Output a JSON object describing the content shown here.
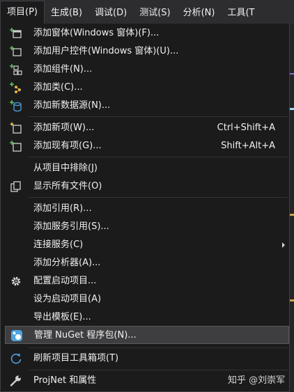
{
  "menubar": {
    "items": [
      {
        "label": "项目(P)"
      },
      {
        "label": "生成(B)"
      },
      {
        "label": "调试(D)"
      },
      {
        "label": "测试(S)"
      },
      {
        "label": "分析(N)"
      },
      {
        "label": "工具(T"
      }
    ]
  },
  "menu": {
    "add_form": {
      "label": "添加窗体(Windows 窗体)(F)...",
      "icon": "form-add-icon"
    },
    "add_user_control": {
      "label": "添加用户控件(Windows 窗体)(U)...",
      "icon": "user-control-add-icon"
    },
    "add_component": {
      "label": "添加组件(N)...",
      "icon": "component-add-icon"
    },
    "add_class": {
      "label": "添加类(C)...",
      "icon": "class-add-icon"
    },
    "add_data_source": {
      "label": "添加新数据源(N)...",
      "icon": "data-source-add-icon"
    },
    "add_new_item": {
      "label": "添加新项(W)...",
      "shortcut": "Ctrl+Shift+A",
      "icon": "new-item-icon"
    },
    "add_existing_item": {
      "label": "添加现有项(G)...",
      "shortcut": "Shift+Alt+A",
      "icon": "existing-item-icon"
    },
    "exclude": {
      "label": "从项目中排除(J)"
    },
    "show_all_files": {
      "label": "显示所有文件(O)",
      "icon": "show-all-files-icon"
    },
    "add_reference": {
      "label": "添加引用(R)..."
    },
    "add_service_reference": {
      "label": "添加服务引用(S)..."
    },
    "connected_services": {
      "label": "连接服务(C)"
    },
    "add_analyzer": {
      "label": "添加分析器(A)..."
    },
    "configure_startup": {
      "label": "配置启动项目...",
      "icon": "gear-icon"
    },
    "set_startup": {
      "label": "设为启动项目(A)"
    },
    "export_template": {
      "label": "导出模板(E)..."
    },
    "manage_nuget": {
      "label": "管理 NuGet 程序包(N)...",
      "icon": "nuget-icon"
    },
    "refresh_toolbox": {
      "label": "刷新项目工具箱项(T)",
      "icon": "refresh-icon"
    },
    "properties": {
      "label": "ProjNet 和属性",
      "icon": "wrench-icon"
    }
  },
  "watermark": "知乎 @刘崇军",
  "colors": {
    "menu_bg": "#1b1b1c",
    "menubar_bg": "#2d2d30",
    "highlight": "#3e3e40",
    "text": "#f1f1f1",
    "icon_green": "#5fc25f",
    "icon_blue": "#4fa3e0"
  }
}
